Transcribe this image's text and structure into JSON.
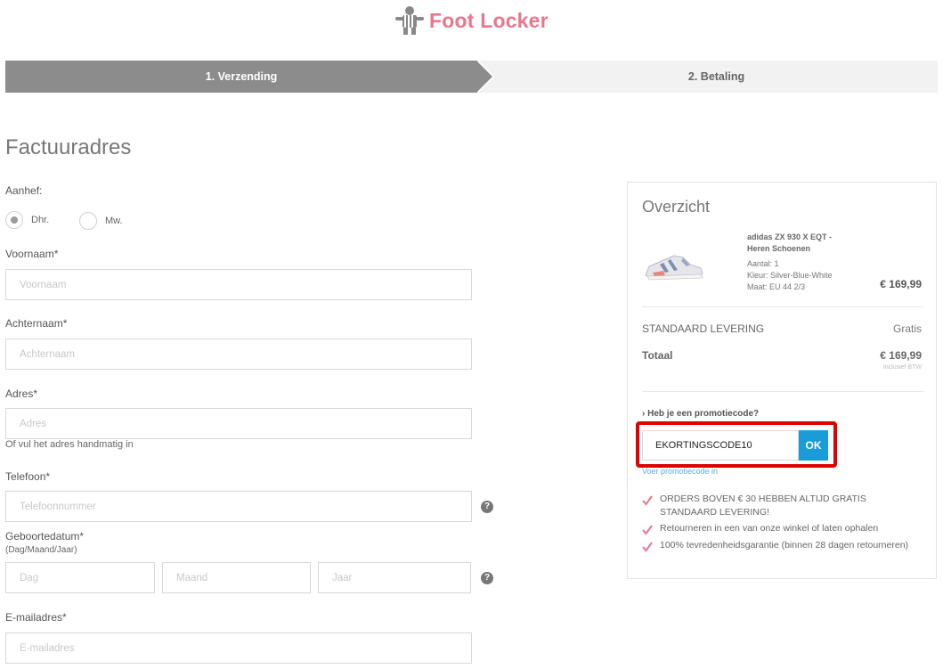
{
  "header": {
    "brand": "Foot Locker",
    "logo_icon": "referee-icon",
    "brand_color": "#e8768c"
  },
  "steps": {
    "step1": "1. Verzending",
    "step2": "2. Betaling",
    "active_color": "#8c8c8c"
  },
  "form": {
    "title": "Factuuradres",
    "salutation_label": "Aanhef:",
    "salutation_options": [
      "Dhr.",
      "Mw."
    ],
    "salutation_selected": "Dhr.",
    "firstname_label": "Voornaam*",
    "firstname_placeholder": "Voornaam",
    "lastname_label": "Achternaam*",
    "lastname_placeholder": "Achternaam",
    "address_label": "Adres*",
    "address_placeholder": "Adres",
    "address_manual": "Of vul het adres handmatig in",
    "phone_label": "Telefoon*",
    "phone_placeholder": "Telefoonnummer",
    "dob_label": "Geboortedatum*",
    "dob_hint": "(Dag/Maand/Jaar)",
    "dob_day_placeholder": "Dag",
    "dob_month_placeholder": "Maand",
    "dob_year_placeholder": "Jaar",
    "email_label": "E-mailadres*",
    "email_placeholder": "E-mailadres",
    "help_glyph": "?"
  },
  "overview": {
    "title": "Overzicht",
    "product": {
      "name_line1": "adidas ZX 930 X EQT -",
      "name_line2": "Heren Schoenen",
      "quantity": "Aantal: 1",
      "color": "Kleur: Silver-Blue-White",
      "size": "Maat: EU 44 2/3",
      "price": "€ 169,99"
    },
    "shipping_label": "STANDAARD LEVERING",
    "shipping_value": "Gratis",
    "total_label": "Totaal",
    "total_value": "€ 169,99",
    "total_note": "Inclusief BTW",
    "promo_question": "Heb je een promotiecode?",
    "promo_value": "EKORTINGSCODE10",
    "promo_button": "OK",
    "promo_hint": "Voer promotiecode in",
    "promo_button_color": "#1a9cd9",
    "highlight_color": "#e00000",
    "benefits": [
      {
        "line1": "ORDERS BOVEN € 30 HEBBEN ALTIJD GRATIS",
        "line2": "STANDAARD LEVERING!"
      },
      {
        "line1": "Retourneren in een van onze winkel of laten ophalen"
      },
      {
        "line1": "100% tevredenheidsgarantie (binnen 28 dagen retourneren)"
      }
    ],
    "check_icon": "check-icon",
    "check_color": "#e8768c"
  }
}
